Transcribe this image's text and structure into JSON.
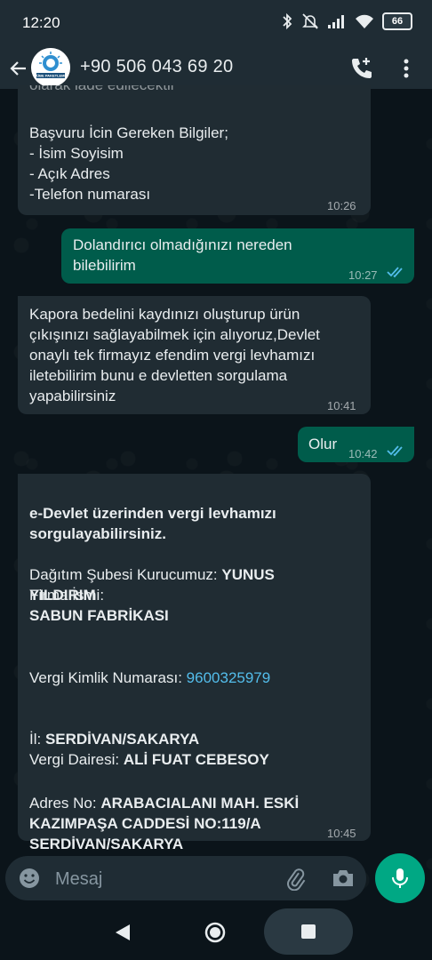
{
  "status_bar": {
    "time": "12:20",
    "battery": "66"
  },
  "header": {
    "contact_name": "+90 506 043 69 20",
    "avatar_text": "TÜBE PAKETLEME"
  },
  "messages": [
    {
      "direction": "in",
      "top_fragment": "olarak iade edilecektir",
      "title": "Başvuru İcin Gereken Bilgiler;",
      "lines": [
        "- İsim Soyisim",
        "- Açık Adres",
        "-Telefon numarası"
      ],
      "time": "10:26"
    },
    {
      "direction": "out",
      "text": "Dolandırıcı olmadığınızı nereden bilebilirim",
      "time": "10:27"
    },
    {
      "direction": "in",
      "text": "Kapora bedelini kaydınızı oluşturup ürün çıkışınızı sağlayabilmek için alıyoruz,Devlet onaylı tek firmayız efendim vergi levhamızı iletebilirim bunu e devletten sorgulama yapabilirsiniz",
      "time": "10:41"
    },
    {
      "direction": "out",
      "text": "Olur",
      "time": "10:42"
    },
    {
      "direction": "in",
      "heading": "e-Devlet üzerinden vergi levhamızı sorgulayabilirsiniz.",
      "founder_label": "Dağıtım Şubesi Kurucumuz: ",
      "founder_value": "YUNUS YILDIRIM",
      "company_label": "Firma İsmi:",
      "company_value": "SABUN FABRİKASI",
      "tax_id_label": "Vergi Kimlik Numarası: ",
      "tax_id_value": "9600325979",
      "city_label": "İl: ",
      "city_value": "SERDİVAN/SAKARYA",
      "tax_office_label": "Vergi Dairesi: ",
      "tax_office_value": "ALİ FUAT CEBESOY",
      "address_label": "Adres No: ",
      "address_value": "ARABACIALANI MAH. ESKİ KAZIMPAŞA CADDESİ NO:119/A SERDİVAN/SAKARYA",
      "time": "10:45"
    }
  ],
  "input": {
    "placeholder": "Mesaj"
  },
  "colors": {
    "incoming": "#202c33",
    "outgoing": "#005c4b",
    "accent": "#00a884",
    "read_ticks": "#53bdeb",
    "link": "#53bdeb"
  }
}
